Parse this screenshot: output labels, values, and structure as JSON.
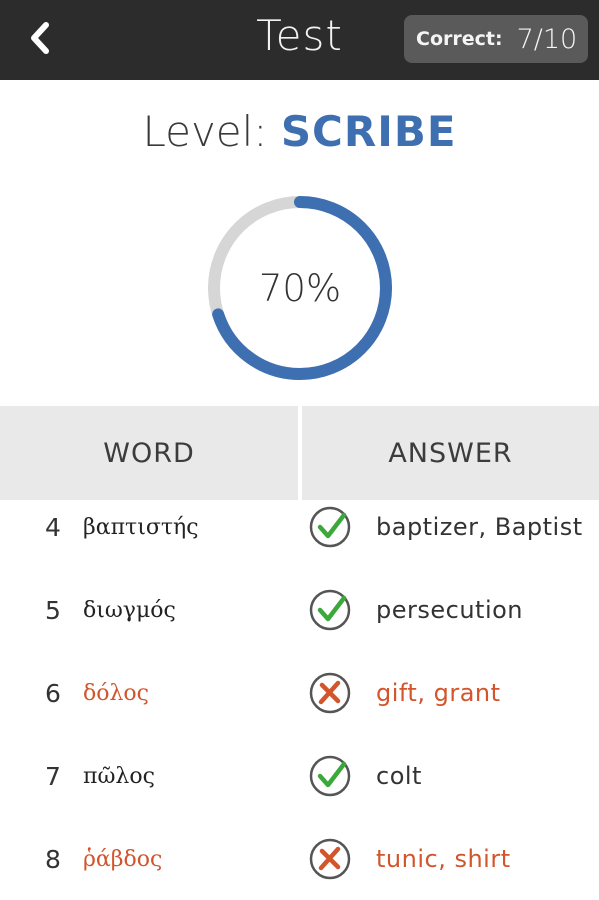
{
  "header": {
    "title": "Test",
    "back_icon": "chevron-left-icon",
    "score_label": "Correct:",
    "score_value": "7/10"
  },
  "level": {
    "label": "Level:",
    "value": "SCRIBE"
  },
  "progress": {
    "percent_text": "70%",
    "fraction": 0.7
  },
  "table": {
    "col_word": "WORD",
    "col_answer": "ANSWER",
    "rows": [
      {
        "num": "4",
        "word": "βαπτιστής",
        "answer": "baptizer, Baptist",
        "correct": true
      },
      {
        "num": "5",
        "word": "διωγμός",
        "answer": "persecution",
        "correct": true
      },
      {
        "num": "6",
        "word": "δόλος",
        "answer": "gift, grant",
        "correct": false
      },
      {
        "num": "7",
        "word": "πῶλος",
        "answer": "colt",
        "correct": true
      },
      {
        "num": "8",
        "word": "ῥάβδος",
        "answer": "tunic, shirt",
        "correct": false
      }
    ]
  },
  "colors": {
    "accent": "#3e6fb0",
    "correct": "#3aa83a",
    "wrong": "#d2552c",
    "header_bg": "#2c2c2c"
  }
}
